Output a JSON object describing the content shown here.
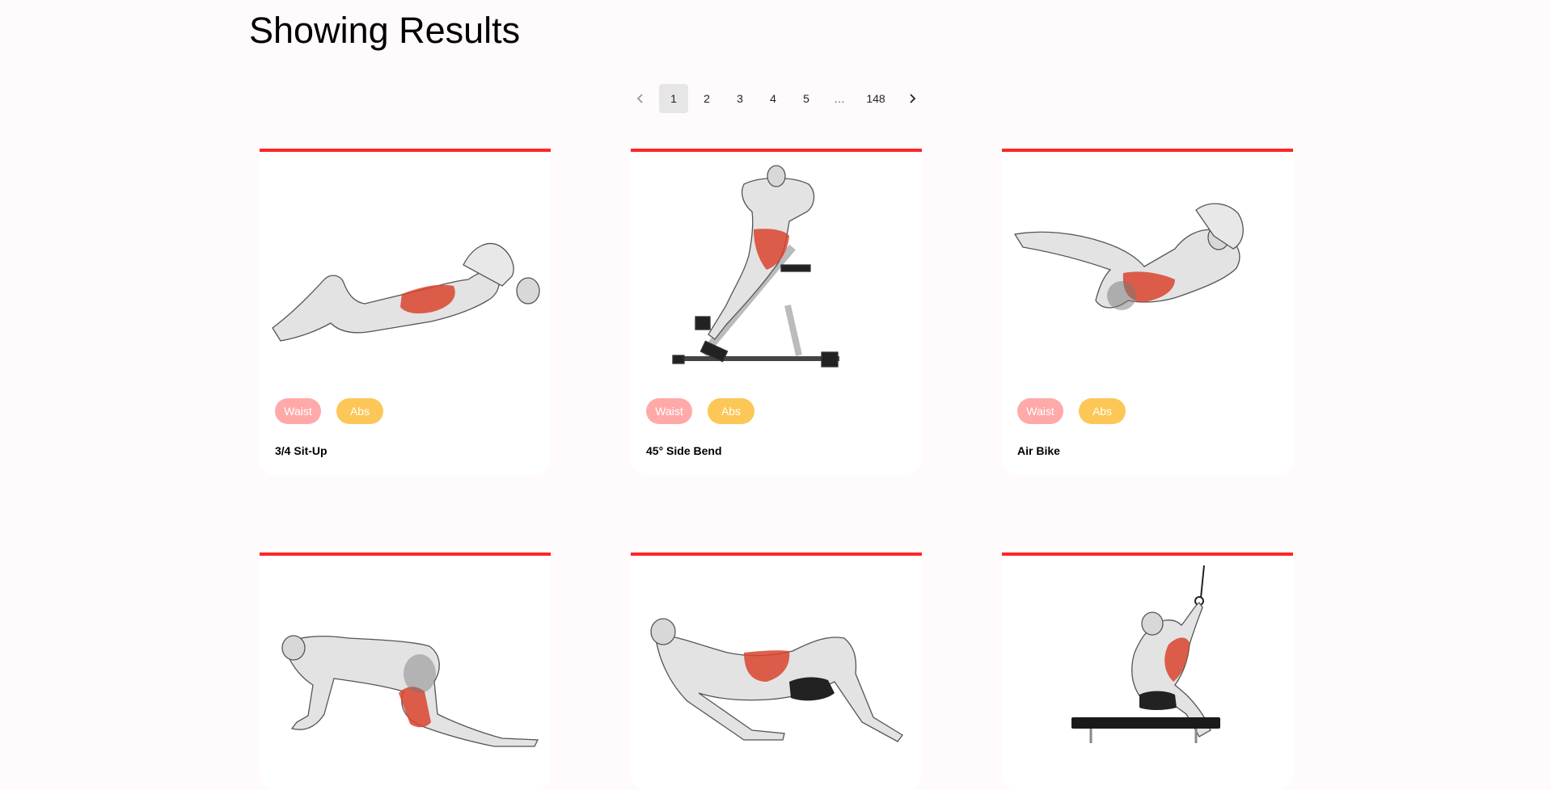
{
  "page": {
    "title": "Showing Results"
  },
  "pagination": {
    "prev_icon": "chevron-left-icon",
    "next_icon": "chevron-right-icon",
    "pages": [
      "1",
      "2",
      "3",
      "4",
      "5"
    ],
    "ellipsis": "…",
    "last": "148",
    "current": "1"
  },
  "exercises": [
    {
      "name": "3/4 Sit-Up",
      "body_part": "Waist",
      "target": "Abs"
    },
    {
      "name": "45° Side Bend",
      "body_part": "Waist",
      "target": "Abs"
    },
    {
      "name": "Air Bike",
      "body_part": "Waist",
      "target": "Abs"
    },
    {
      "name": "",
      "body_part": "",
      "target": ""
    },
    {
      "name": "",
      "body_part": "",
      "target": ""
    },
    {
      "name": "",
      "body_part": "",
      "target": ""
    }
  ],
  "colors": {
    "accent": "#ff2625",
    "body_tag": "#ffa9a9",
    "target_tag": "#fcc757",
    "background": "#fffafb",
    "muscle_highlight": "#d9442e"
  }
}
